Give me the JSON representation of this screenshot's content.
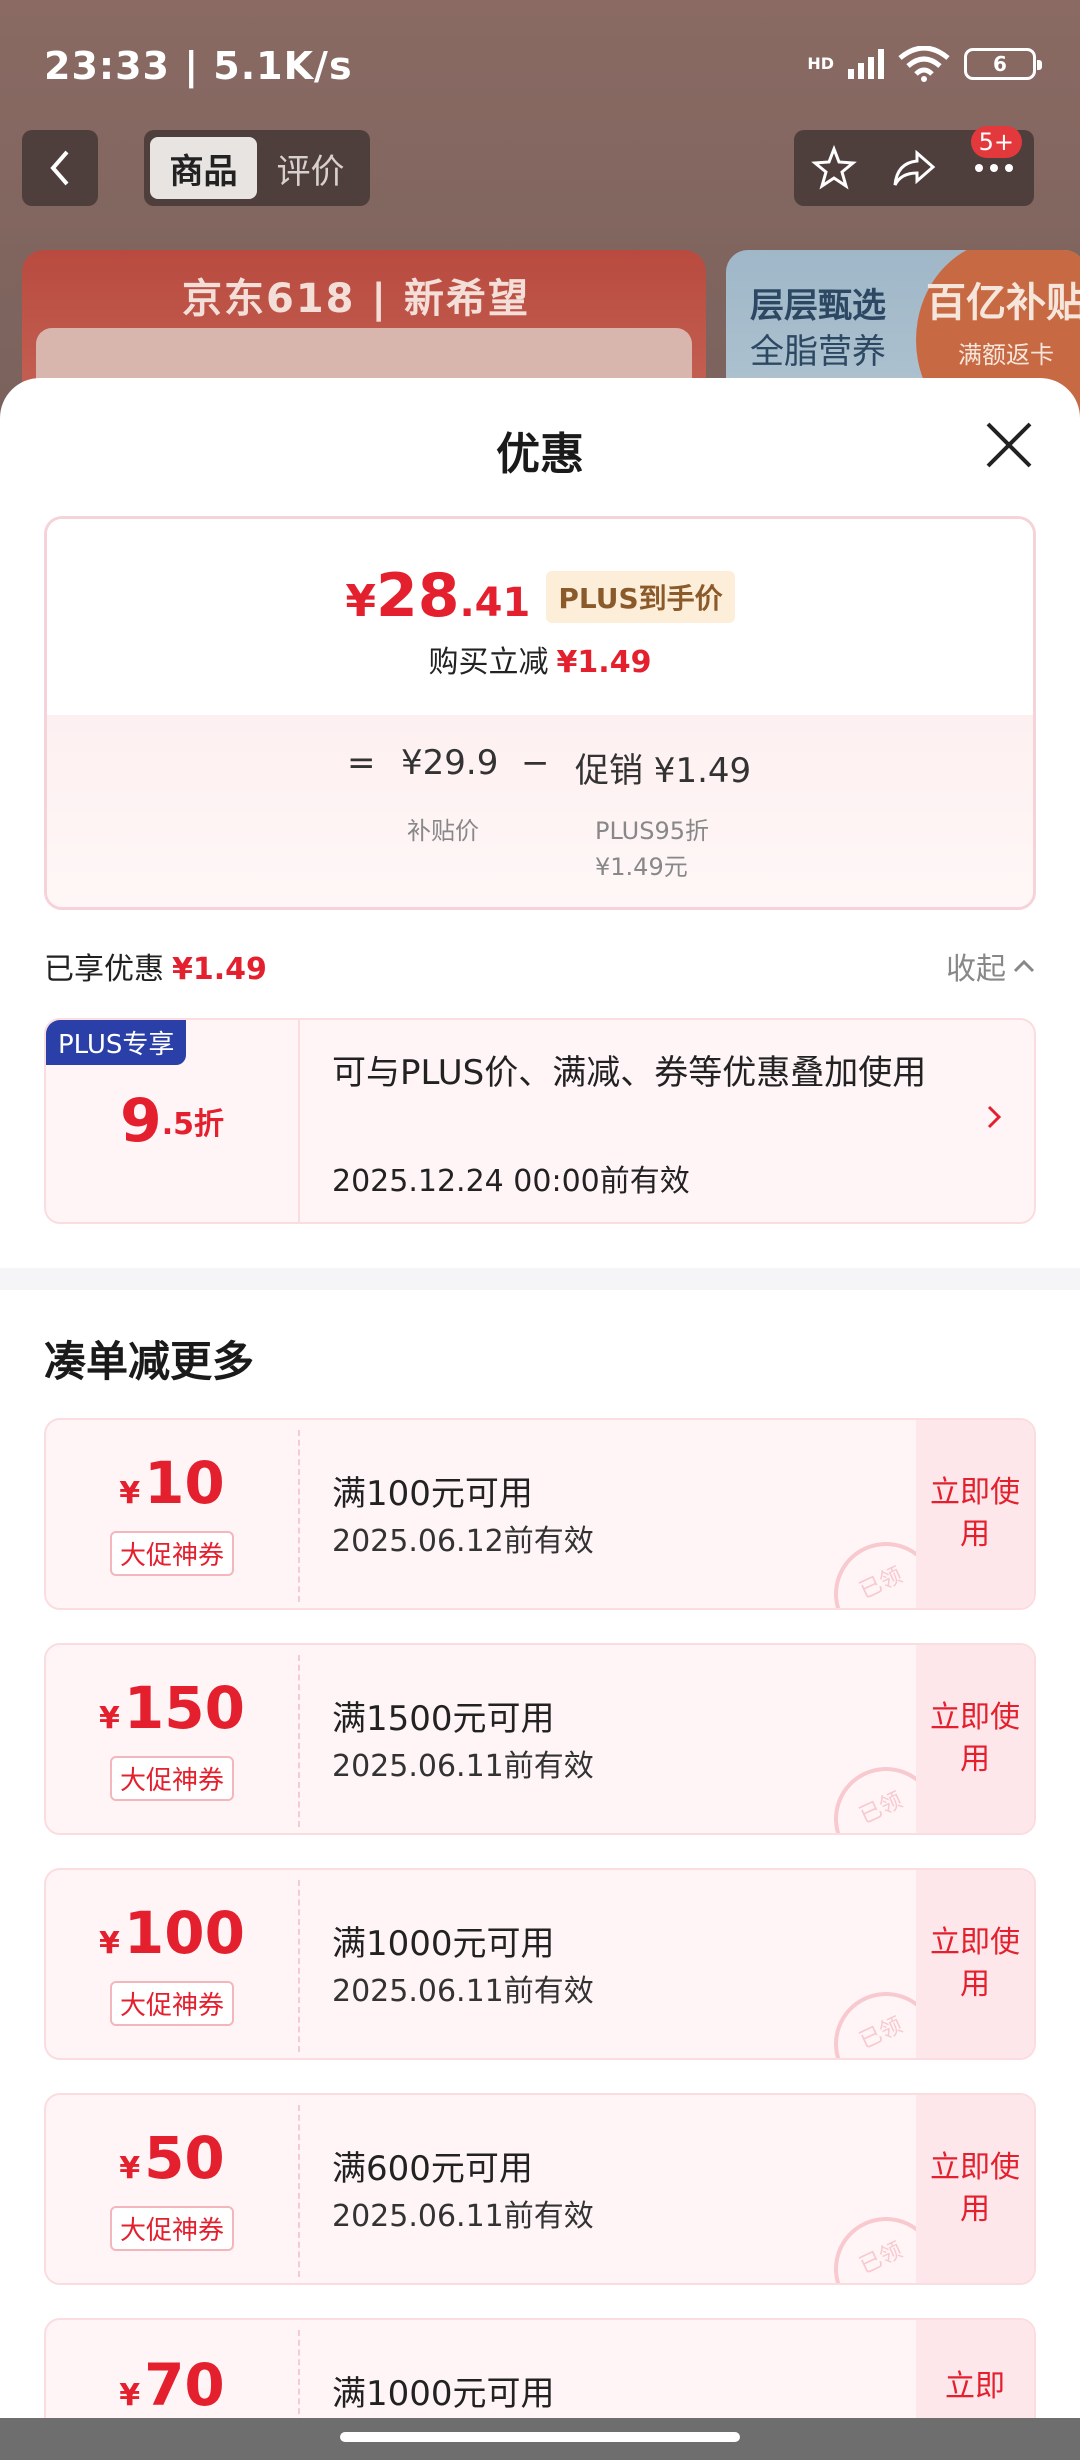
{
  "status": {
    "time": "23:33 | 5.1K/s",
    "signal_tag": "HD",
    "battery": "6"
  },
  "nav": {
    "tabs": [
      {
        "label": "商品"
      },
      {
        "label": "评价"
      }
    ],
    "badge": "5+"
  },
  "banners": {
    "left_title": "京东618 | 新希望",
    "right_line1": "层层甄选",
    "right_line2": "全脂营养",
    "right_tag": "百亿补贴",
    "right_tag_sub": "满额返卡"
  },
  "sheet": {
    "title": "优惠",
    "price": {
      "yen": "¥",
      "integer": "28",
      "decimal": ".41",
      "plus_tag": "PLUS到手价",
      "sub_label": "购买立减",
      "sub_value": "¥1.49",
      "eq": "=",
      "base_price": "¥29.9",
      "minus": "−",
      "promo": "促销 ¥1.49",
      "base_label": "补贴价",
      "promo_label1": "PLUS95折",
      "promo_label2": "¥1.49元"
    },
    "enjoyed": {
      "label": "已享优惠",
      "value": "¥1.49",
      "collapse": "收起"
    },
    "plus_card": {
      "tag": "PLUS专享",
      "discount_big": "9",
      "discount_small": ".5折",
      "text": "可与PLUS价、满减、券等优惠叠加使用",
      "date": "2025.12.24 00:00前有效"
    },
    "section_title": "凑单减更多",
    "coupons": [
      {
        "yen": "¥",
        "amount": "10",
        "badge": "大促神券",
        "desc": "满100元可用",
        "date": "2025.06.12前有效",
        "action": "立即使用",
        "stamp": "已领"
      },
      {
        "yen": "¥",
        "amount": "150",
        "badge": "大促神券",
        "desc": "满1500元可用",
        "date": "2025.06.11前有效",
        "action": "立即使用",
        "stamp": "已领"
      },
      {
        "yen": "¥",
        "amount": "100",
        "badge": "大促神券",
        "desc": "满1000元可用",
        "date": "2025.06.11前有效",
        "action": "立即使用",
        "stamp": "已领"
      },
      {
        "yen": "¥",
        "amount": "50",
        "badge": "大促神券",
        "desc": "满600元可用",
        "date": "2025.06.11前有效",
        "action": "立即使用",
        "stamp": "已领"
      },
      {
        "yen": "¥",
        "amount": "70",
        "badge": "",
        "desc": "满1000元可用",
        "date": "",
        "action": "立即",
        "stamp": ""
      }
    ]
  },
  "colors": {
    "accent_red": "#e4202e",
    "plus_blue": "#2b3fa8"
  }
}
